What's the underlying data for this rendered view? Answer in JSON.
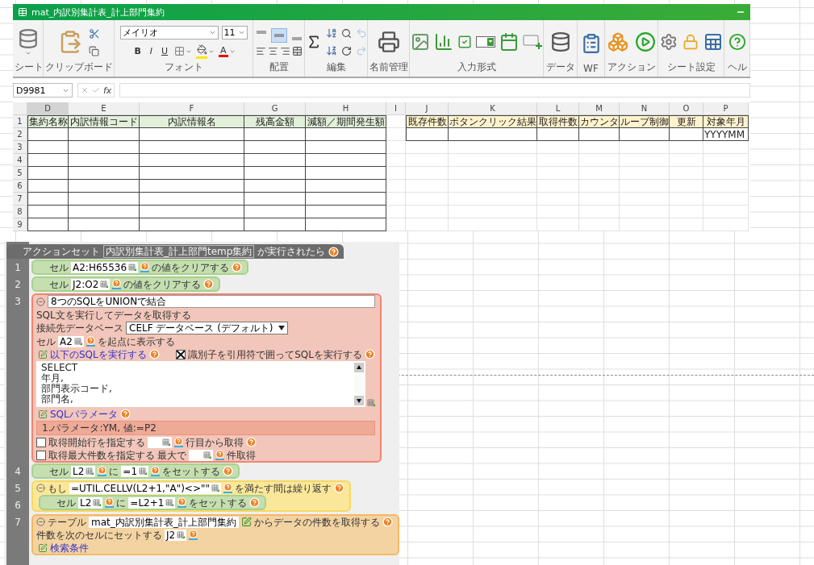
{
  "app_window": {
    "title": "mat_内訳別集計表_計上部門集約"
  },
  "ribbon": {
    "groups": [
      {
        "kind": "sheet",
        "label": "シート"
      },
      {
        "kind": "clipboard",
        "label": "クリップボード"
      },
      {
        "kind": "font",
        "label": "フォント",
        "font_name": "メイリオ",
        "font_size": "11",
        "styles": [
          "B",
          "I",
          "U"
        ],
        "color_glyph": "A"
      },
      {
        "kind": "align",
        "label": "配置",
        "alignment_buttons": [
          {
            "selected": false
          },
          {
            "selected": true
          },
          {
            "selected": false
          }
        ]
      },
      {
        "kind": "edit",
        "label": "編集",
        "history": [
          {
            "disabled": true
          },
          {
            "disabled": true
          }
        ]
      },
      {
        "kind": "names",
        "label": "名前管理"
      },
      {
        "kind": "input",
        "label": "入力形式"
      },
      {
        "kind": "data",
        "label": "データ"
      },
      {
        "kind": "wf",
        "label": "WF"
      },
      {
        "kind": "action",
        "label": "アクション"
      },
      {
        "kind": "sheet_settings",
        "label": "シート設定"
      },
      {
        "kind": "help",
        "label": "ヘル"
      }
    ]
  },
  "formula_bar": {
    "name_box": "D9981",
    "function_label": "fx"
  },
  "sheet": {
    "row_numbers": [
      "1",
      "2",
      "3",
      "4",
      "5",
      "6",
      "7",
      "8",
      "9"
    ],
    "columns": [
      {
        "letter": "D",
        "header": "集約名称",
        "kind": "table"
      },
      {
        "letter": "E",
        "header": "内訳情報コード",
        "kind": "table"
      },
      {
        "letter": "F",
        "header": "内訳情報名",
        "kind": "table"
      },
      {
        "letter": "G",
        "header": "残高金額",
        "kind": "table"
      },
      {
        "letter": "H",
        "header": "減額／期間発生額",
        "kind": "table"
      },
      {
        "letter": "I",
        "kind": "blank"
      },
      {
        "letter": "J",
        "header": "既存件数",
        "kind": "control"
      },
      {
        "letter": "K",
        "header": "ボタンクリック結果",
        "kind": "control"
      },
      {
        "letter": "L",
        "header": "取得件数",
        "kind": "control"
      },
      {
        "letter": "M",
        "header": "カウンタ",
        "kind": "control"
      },
      {
        "letter": "N",
        "header": "ループ制御",
        "kind": "control"
      },
      {
        "letter": "O",
        "header": "更新",
        "kind": "control"
      },
      {
        "letter": "P",
        "header": "対象年月",
        "kind": "control",
        "row_2": "YYYYMM"
      }
    ]
  },
  "action_panel": {
    "header": {
      "prefix": "アクションセット",
      "name": "内訳別集計表_計上部門temp集約",
      "suffix": "が実行されたら"
    },
    "steps": [
      {
        "number": "1",
        "kind": "command",
        "lines": [
          [
            {
              "kind": "text",
              "text": "セル"
            },
            {
              "kind": "cell",
              "value": "A2:H65536"
            },
            {
              "kind": "text",
              "text": "の値をクリアする"
            },
            {
              "kind": "help"
            }
          ]
        ]
      },
      {
        "number": "2",
        "kind": "command",
        "lines": [
          [
            {
              "kind": "text",
              "text": "セル"
            },
            {
              "kind": "cell",
              "value": "J2:O2"
            },
            {
              "kind": "text",
              "text": "の値をクリアする"
            },
            {
              "kind": "help"
            }
          ]
        ]
      },
      {
        "number": "3",
        "kind": "sql",
        "lines": [
          [
            {
              "kind": "toggle",
              "expanded": true
            },
            {
              "kind": "title",
              "value": "8つのSQLをUNIONで結合"
            }
          ],
          [
            {
              "kind": "text",
              "text": "SQL文を実行してデータを取得する"
            }
          ],
          [
            {
              "kind": "text",
              "text": "接続先データベース"
            },
            {
              "kind": "select",
              "value": "CELF データベース (デフォルト)"
            }
          ],
          [
            {
              "kind": "text",
              "text": "セル"
            },
            {
              "kind": "cell",
              "value": "A2"
            },
            {
              "kind": "text",
              "text": "を起点に表示する"
            }
          ],
          [
            {
              "kind": "link",
              "text": "以下のSQLを実行する"
            },
            {
              "kind": "help"
            },
            {
              "kind": "check",
              "checked": true,
              "text": "識別子を引用符で囲ってSQLを実行する"
            },
            {
              "kind": "help"
            }
          ],
          [
            {
              "kind": "sql",
              "lines": [
                "SELECT",
                "年月,",
                "部門表示コード,",
                "部門名,"
              ]
            }
          ],
          [
            {
              "kind": "link",
              "text": "SQLパラメータ"
            },
            {
              "kind": "help"
            }
          ],
          [
            {
              "kind": "param",
              "text": "1.パラメータ:YM, 値:=P2"
            }
          ],
          [
            {
              "kind": "check",
              "checked": false,
              "text": "取得開始行を指定する"
            },
            {
              "kind": "cell"
            },
            {
              "kind": "text",
              "text": "行目から取得"
            },
            {
              "kind": "help"
            }
          ],
          [
            {
              "kind": "check",
              "checked": false,
              "text": "取得最大件数を指定する"
            },
            {
              "kind": "text",
              "text": "最大で"
            },
            {
              "kind": "cell"
            },
            {
              "kind": "text",
              "text": "件取得"
            }
          ]
        ]
      },
      {
        "number": "4",
        "kind": "command",
        "lines": [
          [
            {
              "kind": "text",
              "text": "セル"
            },
            {
              "kind": "cell",
              "value": "L2"
            },
            {
              "kind": "text",
              "text": "に"
            },
            {
              "kind": "cell",
              "value": "=1"
            },
            {
              "kind": "text",
              "text": "をセットする"
            },
            {
              "kind": "help"
            }
          ]
        ]
      },
      {
        "number": "5",
        "kind": "loop",
        "lines": [
          [
            {
              "kind": "toggle",
              "expanded": true
            },
            {
              "kind": "text",
              "text": "もし"
            },
            {
              "kind": "cell",
              "value": "=UTIL.CELLV(L2+1,\"A\")<>\"\""
            },
            {
              "kind": "text",
              "text": "を満たす間は繰り返す"
            },
            {
              "kind": "help"
            }
          ]
        ],
        "children": [
          {
            "number": "6",
            "kind": "command",
            "lines": [
              [
                {
                  "kind": "text",
                  "text": "セル"
                },
                {
                  "kind": "cell",
                  "value": "L2"
                },
                {
                  "kind": "text",
                  "text": "に"
                },
                {
                  "kind": "cell",
                  "value": "=L2+1"
                },
                {
                  "kind": "text",
                  "text": "をセットする"
                },
                {
                  "kind": "help"
                }
              ]
            ]
          }
        ]
      },
      {
        "number": "7",
        "kind": "table",
        "lines": [
          [
            {
              "kind": "toggle",
              "expanded": true
            },
            {
              "kind": "text",
              "text": "テーブル"
            },
            {
              "kind": "table_field",
              "value": "mat_内訳別集計表_計上部門集約"
            },
            {
              "kind": "text",
              "text": "からデータの件数を取得する"
            },
            {
              "kind": "help"
            }
          ],
          [
            {
              "kind": "text",
              "text": "件数を次のセルにセットする"
            },
            {
              "kind": "cell",
              "value": "J2"
            }
          ],
          [
            {
              "kind": "link",
              "text": "検索条件"
            }
          ]
        ]
      }
    ]
  }
}
